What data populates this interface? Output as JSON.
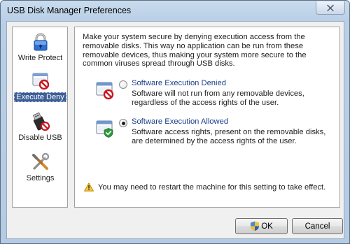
{
  "window": {
    "title": "USB Disk Manager Preferences"
  },
  "sidebar": {
    "items": [
      {
        "label": "Write Protect",
        "icon": "padlock-icon",
        "selected": false
      },
      {
        "label": "Execute Deny",
        "icon": "blocked-window-icon",
        "selected": true
      },
      {
        "label": "Disable USB",
        "icon": "usb-blocked-icon",
        "selected": false
      },
      {
        "label": "Settings",
        "icon": "tools-icon",
        "selected": false
      }
    ]
  },
  "content": {
    "intro": "Make your system secure by denying execution access from the removable disks. This way no application can be run from these removable devices, thus making your system more secure to the common viruses spread through USB disks.",
    "options": [
      {
        "label": "Software Execution Denied",
        "description": "Software will not run from any removable devices, regardless of the access rights of the user.",
        "checked": false,
        "icon": "window-denied-icon"
      },
      {
        "label": "Software Execution Allowed",
        "description": "Software access rights, present on the removable disks, are determined by the access rights of the user.",
        "checked": true,
        "icon": "window-allowed-icon"
      }
    ],
    "warning": "You may need to restart the machine for this setting to take effect."
  },
  "buttons": {
    "ok": "OK",
    "cancel": "Cancel"
  },
  "colors": {
    "link_blue": "#1a3e8a",
    "selection": "#3e5e96",
    "title_gradient_top": "#c9dced"
  }
}
